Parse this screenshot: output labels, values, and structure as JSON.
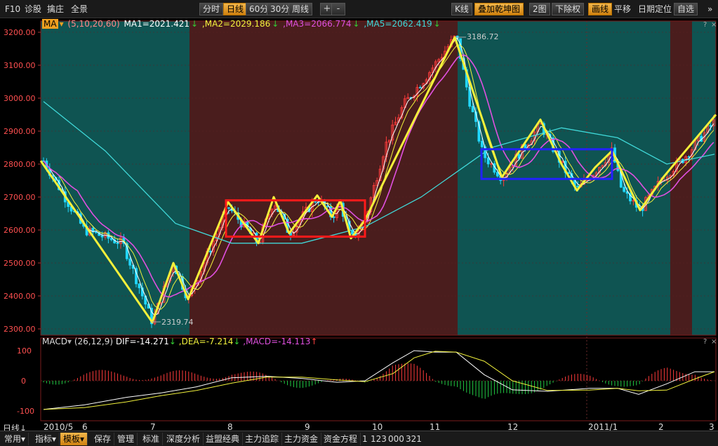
{
  "toolbar": {
    "f10": "F10",
    "diagnose": "诊股",
    "top_picks": "擒庄",
    "overview": "全景",
    "period_buttons": [
      "分时",
      "日线",
      "60分",
      "30分",
      "周线"
    ],
    "active_period": "日线",
    "zoom_in": "+",
    "zoom_out": "-",
    "kline": "K线",
    "overlay": "叠加乾坤图",
    "two_chart": "2图",
    "adjust": "下除权",
    "draw": "画线",
    "pan": "平移",
    "date_locate": "日期定位",
    "watchlist": "自选"
  },
  "ma_legend": {
    "tag": "MA",
    "params": "(5,10,20,60)",
    "ma1": "MA1=2021.421",
    "ma2": ",MA2=2029.186",
    "ma3": ",MA3=2066.774",
    "ma5": ",MA5=2062.419",
    "arrow": "↓"
  },
  "macd_legend": {
    "tag": "MACD",
    "params": "(26,12,9)",
    "dif": "DIF=-14.271",
    "dea": ",DEA=-7.214",
    "macd": ",MACD=-14.113",
    "arrow_down": "↓",
    "arrow_up": "↑"
  },
  "price_axis": [
    "3200.00",
    "3100.00",
    "3000.00",
    "2900.00",
    "2800.00",
    "2700.00",
    "2600.00",
    "2500.00",
    "2400.00",
    "2300.00"
  ],
  "macd_axis": [
    "100",
    "0",
    "-100"
  ],
  "annotations": {
    "high": "3186.72",
    "low": "2319.74"
  },
  "x_axis": {
    "period": "日线",
    "labels": [
      "2010/5",
      "6",
      "7",
      "8",
      "9",
      "10",
      "11",
      "12",
      "2011/1",
      "2",
      "3"
    ]
  },
  "bottom_tabs": [
    "常用",
    "指标",
    "模板",
    "保存",
    "管理",
    "标准",
    "深度分析",
    "益盟经典",
    "主力追踪",
    "主力资金",
    "资金方程",
    "1",
    "123",
    "000",
    "321"
  ],
  "selected_tab": "模板",
  "colors": {
    "teal_zone": "#0f5452",
    "red_zone": "#4a1d1d",
    "ma1": "#ffffff",
    "ma2": "#f2f23c",
    "ma3": "#e050e0",
    "ma5": "#40d8d8",
    "up": "#ff3b3b",
    "down": "#22d8ff",
    "zigzag": "#f5f03a",
    "box_red": "#ff1a1a",
    "box_blue": "#2222ff"
  }
}
